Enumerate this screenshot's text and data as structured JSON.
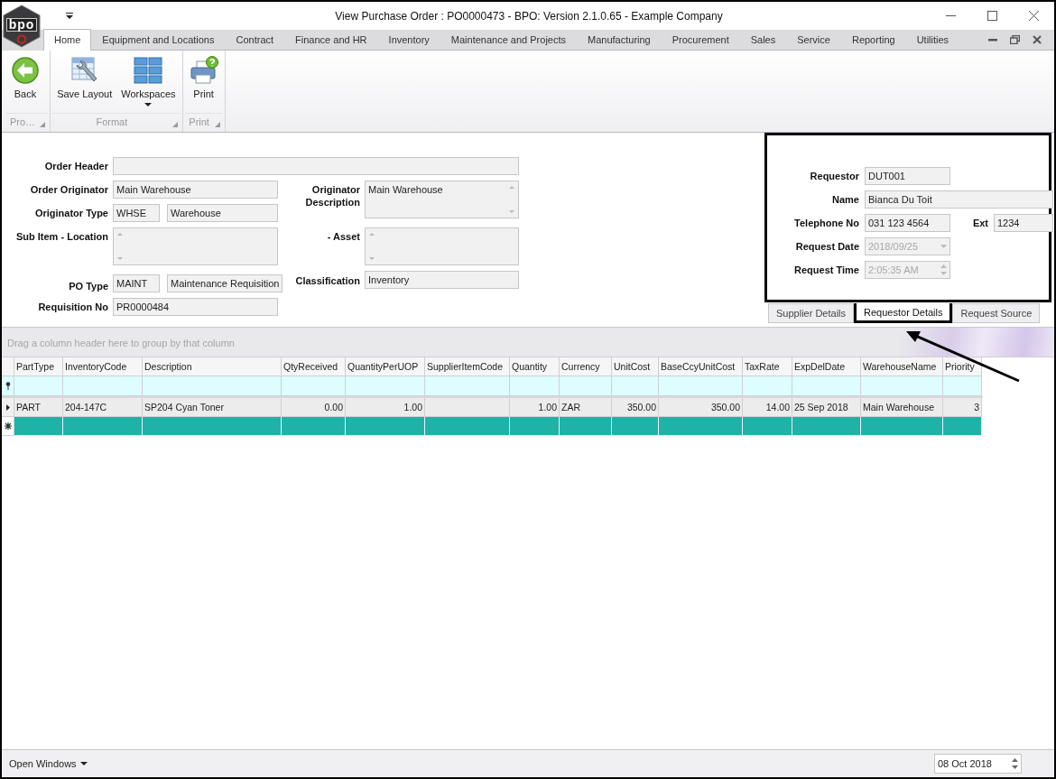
{
  "window": {
    "logo": "bpo",
    "title": "View Purchase Order : PO0000473 - BPO: Version 2.1.0.65 - Example Company"
  },
  "ribbon_tabs": [
    {
      "label": "Home",
      "selected": true
    },
    {
      "label": "Equipment and Locations",
      "selected": false
    },
    {
      "label": "Contract",
      "selected": false
    },
    {
      "label": "Finance and HR",
      "selected": false
    },
    {
      "label": "Inventory",
      "selected": false
    },
    {
      "label": "Maintenance and Projects",
      "selected": false
    },
    {
      "label": "Manufacturing",
      "selected": false
    },
    {
      "label": "Procurement",
      "selected": false
    },
    {
      "label": "Sales",
      "selected": false
    },
    {
      "label": "Service",
      "selected": false
    },
    {
      "label": "Reporting",
      "selected": false
    },
    {
      "label": "Utilities",
      "selected": false
    }
  ],
  "ribbon_groups": [
    {
      "caption": "Pro…",
      "buttons": [
        {
          "label": "Back",
          "kind": "back",
          "dropdown": false
        }
      ]
    },
    {
      "caption": "Format",
      "buttons": [
        {
          "label": "Save Layout",
          "kind": "save-layout",
          "dropdown": false
        },
        {
          "label": "Workspaces",
          "kind": "workspaces",
          "dropdown": true
        }
      ]
    },
    {
      "caption": "Print",
      "buttons": [
        {
          "label": "Print",
          "kind": "print",
          "dropdown": false
        }
      ]
    }
  ],
  "order_form": {
    "order_header": {
      "label": "Order Header"
    },
    "order_originator": {
      "label": "Order Originator",
      "value": "Main Warehouse"
    },
    "originator_type": {
      "label": "Originator Type",
      "code": "WHSE",
      "value": "Warehouse"
    },
    "sub_item_location": {
      "label": "Sub Item - Location"
    },
    "po_type": {
      "label": "PO Type",
      "code": "MAINT",
      "value": "Maintenance Requisition"
    },
    "requisition_no": {
      "label": "Requisition No",
      "value": "PR0000484"
    },
    "originator_description": {
      "label": "Originator Description",
      "value": "Main Warehouse"
    },
    "asset": {
      "label": "- Asset"
    },
    "classification": {
      "label": "Classification",
      "value": "Inventory"
    }
  },
  "requestor_panel": {
    "requestor": {
      "label": "Requestor",
      "value": "DUT001",
      "disabled": false
    },
    "name": {
      "label": "Name",
      "value": "Bianca Du Toit",
      "disabled": false
    },
    "telephone_no": {
      "label": "Telephone No",
      "value": "031 123 4564",
      "disabled": false
    },
    "ext": {
      "label": "Ext",
      "value": "1234",
      "disabled": false
    },
    "request_date": {
      "label": "Request Date",
      "value": "2018/09/25",
      "disabled": true
    },
    "request_time": {
      "label": "Request Time",
      "value": "2:05:35 AM",
      "disabled": true
    }
  },
  "detail_tabs": [
    {
      "label": "Supplier Details",
      "selected": false
    },
    {
      "label": "Requestor Details",
      "selected": true
    },
    {
      "label": "Request Source",
      "selected": false
    }
  ],
  "grid": {
    "group_panel_hint": "Drag a column header here to group by that column",
    "columns": [
      {
        "label": "PartType"
      },
      {
        "label": "InventoryCode"
      },
      {
        "label": "Description"
      },
      {
        "label": "QtyReceived"
      },
      {
        "label": "QuantityPerUOP"
      },
      {
        "label": "SupplierItemCode"
      },
      {
        "label": "Quantity"
      },
      {
        "label": "Currency"
      },
      {
        "label": "UnitCost"
      },
      {
        "label": "BaseCcyUnitCost"
      },
      {
        "label": "TaxRate"
      },
      {
        "label": "ExpDelDate"
      },
      {
        "label": "WarehouseName"
      },
      {
        "label": "Priority"
      }
    ],
    "rows": [
      {
        "current": true,
        "cells": [
          "PART",
          "204-147C",
          "SP204 Cyan Toner",
          "0.00",
          "1.00",
          null,
          "1.00",
          "ZAR",
          "350.00",
          "350.00",
          "14.00",
          "25 Sep 2018",
          "Main Warehouse",
          "3"
        ]
      }
    ]
  },
  "status_bar": {
    "open_windows": "Open Windows",
    "date": "08 Oct 2018"
  }
}
